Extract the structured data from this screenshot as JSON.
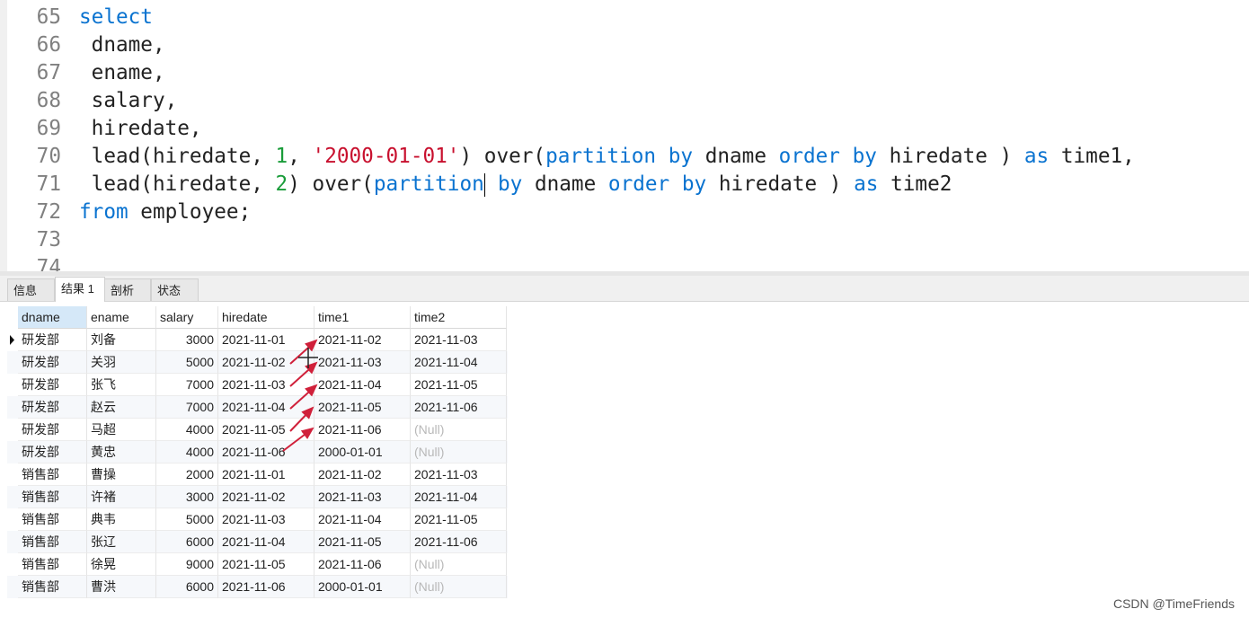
{
  "editor": {
    "lines": [
      {
        "n": "65",
        "tokens": [
          [
            "select",
            "kw"
          ]
        ]
      },
      {
        "n": "66",
        "tokens": [
          [
            " dname,",
            "pl"
          ]
        ]
      },
      {
        "n": "67",
        "tokens": [
          [
            " ename,",
            "pl"
          ]
        ]
      },
      {
        "n": "68",
        "tokens": [
          [
            " salary,",
            "pl"
          ]
        ]
      },
      {
        "n": "69",
        "tokens": [
          [
            " hiredate,",
            "pl"
          ]
        ]
      },
      {
        "n": "70",
        "tokens": [
          [
            " lead(hiredate, ",
            "pl"
          ],
          [
            "1",
            "num"
          ],
          [
            ", ",
            "pl"
          ],
          [
            "'2000-01-01'",
            "str"
          ],
          [
            ") over(",
            "pl"
          ],
          [
            "partition",
            "kw"
          ],
          [
            " ",
            "pl"
          ],
          [
            "by",
            "kw"
          ],
          [
            " dname ",
            "pl"
          ],
          [
            "order",
            "kw"
          ],
          [
            " ",
            "pl"
          ],
          [
            "by",
            "kw"
          ],
          [
            " hiredate ) ",
            "pl"
          ],
          [
            "as",
            "kw"
          ],
          [
            " time1,",
            "pl"
          ]
        ]
      },
      {
        "n": "71",
        "tokens": [
          [
            " lead(hiredate, ",
            "pl"
          ],
          [
            "2",
            "num"
          ],
          [
            ") over(",
            "pl"
          ],
          [
            "partition",
            "kw"
          ],
          [
            "|caret",
            "caret"
          ],
          [
            " ",
            "pl"
          ],
          [
            "by",
            "kw"
          ],
          [
            " dname ",
            "pl"
          ],
          [
            "order",
            "kw"
          ],
          [
            " ",
            "pl"
          ],
          [
            "by",
            "kw"
          ],
          [
            " hiredate ) ",
            "pl"
          ],
          [
            "as",
            "kw"
          ],
          [
            " time2",
            "pl"
          ]
        ]
      },
      {
        "n": "72",
        "tokens": [
          [
            "from",
            "kw"
          ],
          [
            " employee;",
            "pl"
          ]
        ]
      },
      {
        "n": "73",
        "tokens": []
      },
      {
        "n": "74",
        "tokens": []
      }
    ]
  },
  "tabs": [
    {
      "label": "信息"
    },
    {
      "label": "结果 1",
      "active": true
    },
    {
      "label": "剖析"
    },
    {
      "label": "状态"
    }
  ],
  "grid": {
    "columns": [
      "dname",
      "ename",
      "salary",
      "hiredate",
      "time1",
      "time2"
    ],
    "rows": [
      [
        "研发部",
        "刘备",
        "3000",
        "2021-11-01",
        "2021-11-02",
        "2021-11-03"
      ],
      [
        "研发部",
        "关羽",
        "5000",
        "2021-11-02",
        "2021-11-03",
        "2021-11-04"
      ],
      [
        "研发部",
        "张飞",
        "7000",
        "2021-11-03",
        "2021-11-04",
        "2021-11-05"
      ],
      [
        "研发部",
        "赵云",
        "7000",
        "2021-11-04",
        "2021-11-05",
        "2021-11-06"
      ],
      [
        "研发部",
        "马超",
        "4000",
        "2021-11-05",
        "2021-11-06",
        "(Null)"
      ],
      [
        "研发部",
        "黄忠",
        "4000",
        "2021-11-06",
        "2000-01-01",
        "(Null)"
      ],
      [
        "销售部",
        "曹操",
        "2000",
        "2021-11-01",
        "2021-11-02",
        "2021-11-03"
      ],
      [
        "销售部",
        "许褚",
        "3000",
        "2021-11-02",
        "2021-11-03",
        "2021-11-04"
      ],
      [
        "销售部",
        "典韦",
        "5000",
        "2021-11-03",
        "2021-11-04",
        "2021-11-05"
      ],
      [
        "销售部",
        "张辽",
        "6000",
        "2021-11-04",
        "2021-11-05",
        "2021-11-06"
      ],
      [
        "销售部",
        "徐晃",
        "9000",
        "2021-11-05",
        "2021-11-06",
        "(Null)"
      ],
      [
        "销售部",
        "曹洪",
        "6000",
        "2021-11-06",
        "2000-01-01",
        "(Null)"
      ]
    ]
  },
  "watermark": "CSDN @TimeFriends",
  "colors": {
    "keyword": "#0a73d0",
    "number": "#1a9c3a",
    "string": "#c8102e",
    "annotation": "#d0203a"
  }
}
